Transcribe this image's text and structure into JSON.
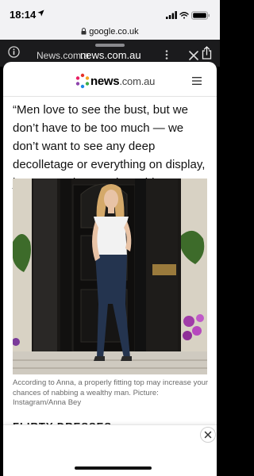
{
  "status_bar": {
    "time": "18:14"
  },
  "browser": {
    "url": "google.co.uk",
    "behind_title": "News.com.a",
    "sheet_title": "news.com.au"
  },
  "site": {
    "logo_name": "news",
    "logo_tld": ".com.au",
    "logo_dot_colors": [
      "#e63329",
      "#f5a623",
      "#3fae49",
      "#1e88e5",
      "#8e44ad",
      "#e91e63"
    ]
  },
  "article": {
    "quote": "“Men love to see the bust, but we don’t have to be too much — we don’t want to see any deep decolletage or everything on display, just some shape,” she said.",
    "caption": "According to Anna, a properly fitting top may increase your chances of nabbing a wealthy man. Picture: Instagram/Anna Bey",
    "next_heading": "FLIRTY DRESSES"
  },
  "icons": {
    "location": "location-arrow-icon",
    "signal": "signal-icon",
    "wifi": "wifi-icon",
    "battery": "battery-icon",
    "lock": "lock-icon",
    "info": "info-icon",
    "more": "more-dots-icon",
    "close": "close-icon",
    "share": "share-icon",
    "menu": "hamburger-menu-icon",
    "ad_close": "ad-close-icon"
  }
}
